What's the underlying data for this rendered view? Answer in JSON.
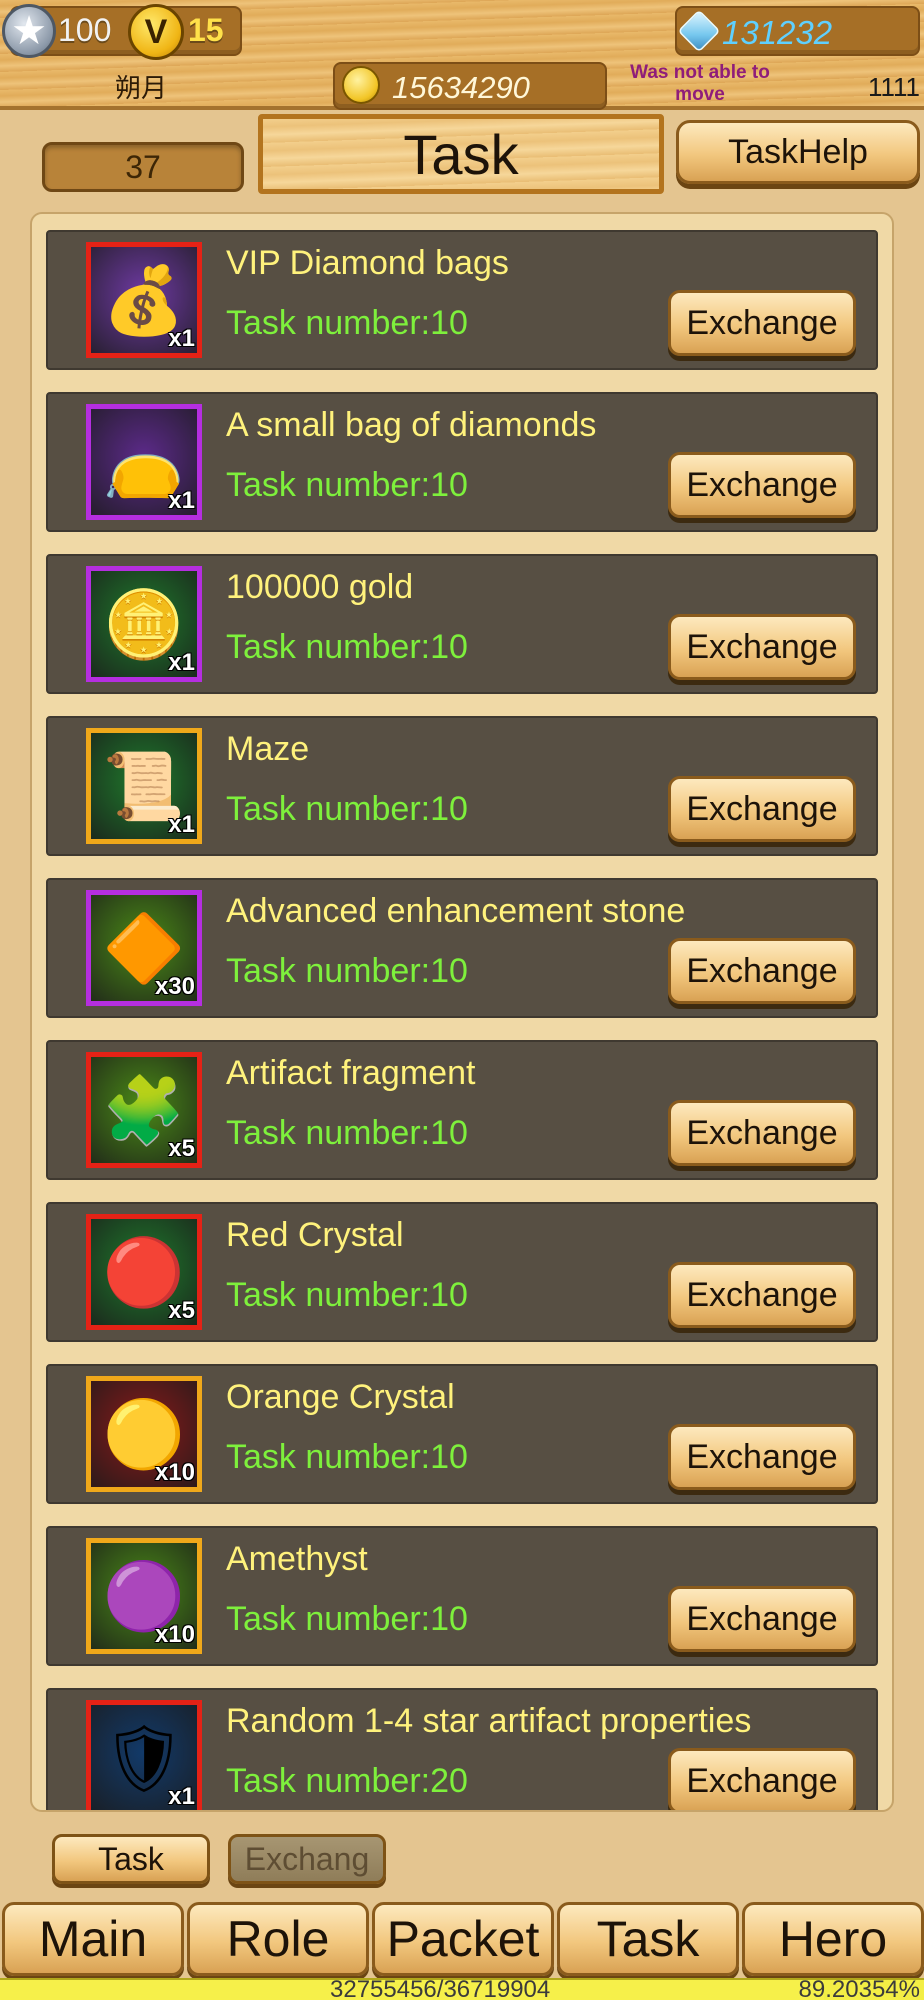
{
  "header": {
    "level": "100",
    "vip_letter": "V",
    "vip_level": "15",
    "player_name": "朔月",
    "diamonds": "131232",
    "gold": "15634290",
    "status_message": "Was not able to move",
    "right_number": "1111"
  },
  "page": {
    "count": "37",
    "title": "Task",
    "help_label": "TaskHelp"
  },
  "tasks": [
    {
      "name": "VIP Diamond bags",
      "task": "Task number:10",
      "qty": "x1",
      "icon": "diamond-bag-icon",
      "glyph": "💰",
      "border": "#e52216",
      "bg": "#6f3aa4",
      "button": "Exchange"
    },
    {
      "name": "A small bag of diamonds",
      "task": "Task number:10",
      "qty": "x1",
      "icon": "small-bag-icon",
      "glyph": "👝",
      "border": "#b52ee0",
      "bg": "#5c2a8a",
      "button": "Exchange"
    },
    {
      "name": "100000 gold",
      "task": "Task number:10",
      "qty": "x1",
      "icon": "gold-coin-icon",
      "glyph": "🪙",
      "border": "#b52ee0",
      "bg": "#1f7a2c",
      "button": "Exchange"
    },
    {
      "name": "Maze",
      "task": "Task number:10",
      "qty": "x1",
      "icon": "maze-token-icon",
      "glyph": "📜",
      "border": "#f0a81a",
      "bg": "#1f7a2c",
      "button": "Exchange"
    },
    {
      "name": "Advanced enhancement stone",
      "task": "Task number:10",
      "qty": "x30",
      "icon": "enhancement-stone-icon",
      "glyph": "🔶",
      "border": "#b52ee0",
      "bg": "#4a8a16",
      "button": "Exchange"
    },
    {
      "name": "Artifact fragment",
      "task": "Task number:10",
      "qty": "x5",
      "icon": "artifact-fragment-icon",
      "glyph": "🧩",
      "border": "#e52216",
      "bg": "#4a8a16",
      "button": "Exchange"
    },
    {
      "name": "Red Crystal",
      "task": "Task number:10",
      "qty": "x5",
      "icon": "red-crystal-icon",
      "glyph": "🔴",
      "border": "#e52216",
      "bg": "#1f7a2c",
      "button": "Exchange"
    },
    {
      "name": "Orange Crystal",
      "task": "Task number:10",
      "qty": "x10",
      "icon": "orange-crystal-icon",
      "glyph": "🟡",
      "border": "#f0a81a",
      "bg": "#8a1a1a",
      "button": "Exchange"
    },
    {
      "name": "Amethyst",
      "task": "Task number:10",
      "qty": "x10",
      "icon": "amethyst-icon",
      "glyph": "🟣",
      "border": "#f0a81a",
      "bg": "#4a8a16",
      "button": "Exchange"
    },
    {
      "name": "Random 1-4 star artifact properties",
      "task": "Task number:20",
      "qty": "x1",
      "icon": "artifact-armor-icon",
      "glyph": "🛡",
      "border": "#e52216",
      "bg": "#123a6a",
      "button": "Exchange"
    }
  ],
  "subtabs": {
    "task": "Task",
    "exchange": "Exchang"
  },
  "nav": [
    "Main",
    "Role",
    "Packet",
    "Task",
    "Hero"
  ],
  "xp": {
    "text": "32755456/36719904",
    "percent": "89.20354%",
    "fraction": 0.892
  }
}
